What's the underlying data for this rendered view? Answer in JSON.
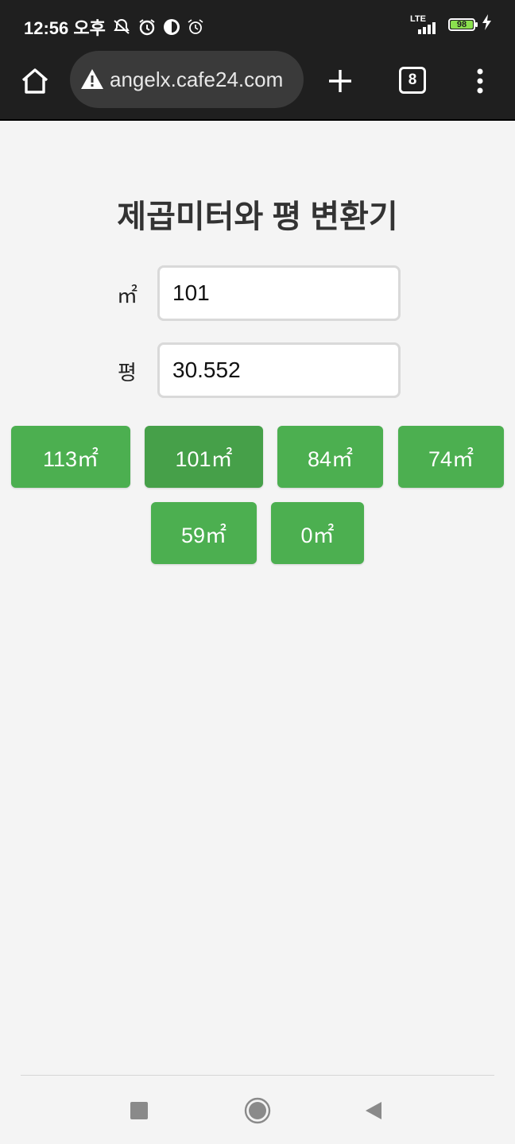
{
  "status_bar": {
    "time": "12:56 오후",
    "network": "LTE",
    "battery": "98",
    "icons": [
      "mute-icon",
      "alarm-clock-icon",
      "app-notification-icon",
      "alarm-icon",
      "signal-icon",
      "battery-icon",
      "charging-bolt-icon"
    ]
  },
  "browser": {
    "url": "angelx.cafe24.com",
    "tab_count": "8",
    "icons": [
      "home-icon",
      "warning-icon",
      "new-tab-plus-icon",
      "tabs-icon",
      "more-menu-icon"
    ]
  },
  "main": {
    "title": "제곱미터와 평 변환기",
    "sqm_label": "㎡",
    "sqm_value": "101",
    "pyeong_label": "평",
    "pyeong_value": "30.552",
    "presets": [
      {
        "label": "113㎡",
        "active": false
      },
      {
        "label": "101㎡",
        "active": true
      },
      {
        "label": "84㎡",
        "active": false
      },
      {
        "label": "74㎡",
        "active": false
      },
      {
        "label": "59㎡",
        "active": false
      },
      {
        "label": "0㎡",
        "active": false
      }
    ]
  },
  "colors": {
    "accent": "#4caf50",
    "accent_active": "#46a049",
    "toolbar_bg": "#1f1f1f",
    "page_bg": "#f4f4f4"
  },
  "nav": {
    "icons": [
      "recent-apps-icon",
      "home-circle-icon",
      "back-icon"
    ]
  }
}
